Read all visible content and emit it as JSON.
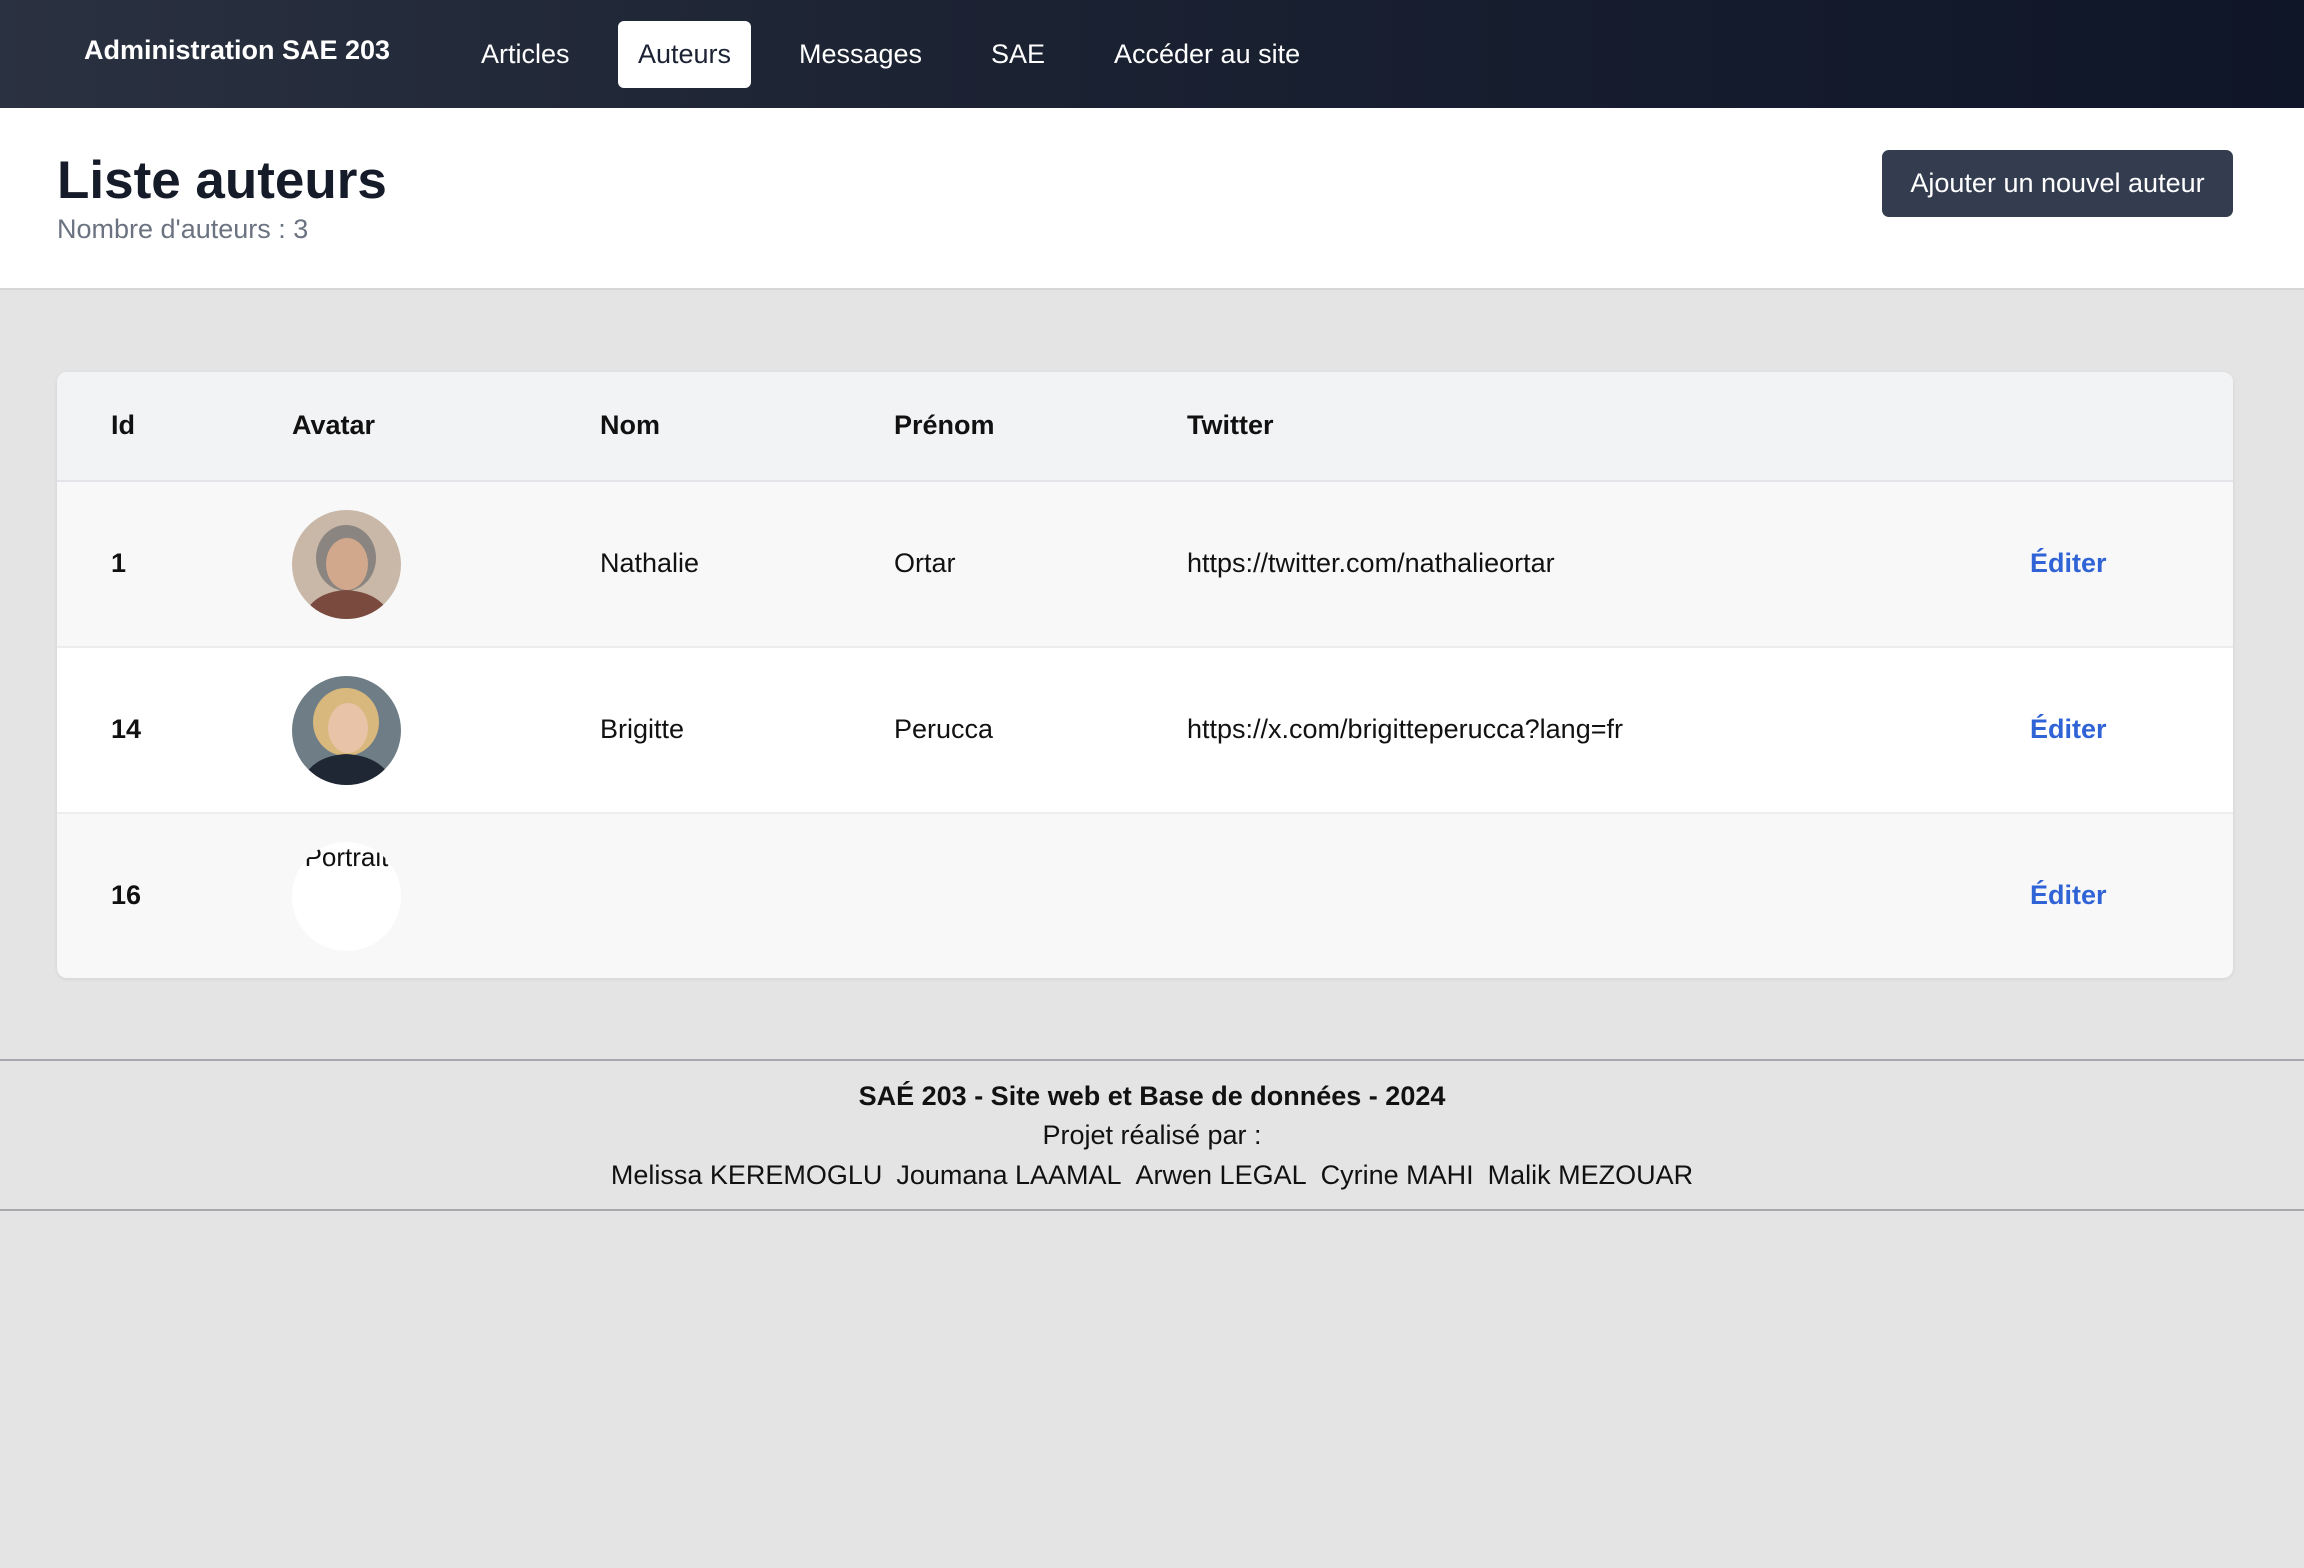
{
  "navbar": {
    "brand": "Administration SAE 203",
    "items": [
      {
        "label": "Articles",
        "active": false
      },
      {
        "label": "Auteurs",
        "active": true
      },
      {
        "label": "Messages",
        "active": false
      },
      {
        "label": "SAE",
        "active": false
      },
      {
        "label": "Accéder au site",
        "active": false
      }
    ]
  },
  "header": {
    "title": "Liste auteurs",
    "count_text": "Nombre d'auteurs : 3",
    "add_button": "Ajouter un nouvel auteur"
  },
  "table": {
    "columns": [
      "Id",
      "Avatar",
      "Nom",
      "Prénom",
      "Twitter"
    ],
    "rows": [
      {
        "id": "1",
        "avatar": "portrait-photo-gray-haired-woman",
        "nom": "Nathalie",
        "prenom": "Ortar",
        "twitter": "https://twitter.com/nathalieortar",
        "action": "Éditer"
      },
      {
        "id": "14",
        "avatar": "portrait-photo-blonde-woman",
        "nom": "Brigitte",
        "prenom": "Perucca",
        "twitter": "https://x.com/brigitteperucca?lang=fr",
        "action": "Éditer"
      },
      {
        "id": "16",
        "avatar_alt": "Portrait",
        "nom": "",
        "prenom": "",
        "twitter": "",
        "action": "Éditer"
      }
    ]
  },
  "footer": {
    "title": "SAÉ 203 - Site web et Base de données - 2024",
    "subtitle": "Projet réalisé par :",
    "members": [
      "Melissa KEREMOGLU",
      "Joumana LAAMAL",
      "Arwen LEGAL",
      "Cyrine MAHI",
      "Malik MEZOUAR"
    ]
  },
  "colors": {
    "navbar": "#1c2333",
    "button": "#333d4f",
    "link": "#2f63d6",
    "background": "#e4e4e4"
  }
}
